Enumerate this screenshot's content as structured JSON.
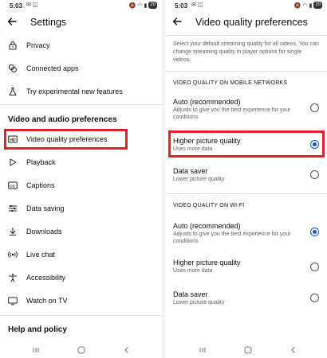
{
  "status_bar": {
    "time": "5:03",
    "battery": "20"
  },
  "settings": {
    "title": "Settings",
    "items_top": [
      {
        "label": "Privacy",
        "icon": "lock-icon"
      },
      {
        "label": "Connected apps",
        "icon": "link-icon"
      },
      {
        "label": "Try experimental new features",
        "icon": "flask-icon"
      }
    ],
    "section_video": "Video and audio preferences",
    "items_video": [
      {
        "label": "Video quality preferences",
        "icon": "hd-icon"
      },
      {
        "label": "Playback",
        "icon": "play-icon"
      },
      {
        "label": "Captions",
        "icon": "cc-icon"
      },
      {
        "label": "Data saving",
        "icon": "sliders-icon"
      },
      {
        "label": "Downloads",
        "icon": "download-icon"
      },
      {
        "label": "Live chat",
        "icon": "live-icon"
      },
      {
        "label": "Accessibility",
        "icon": "accessibility-icon"
      },
      {
        "label": "Watch on TV",
        "icon": "tv-icon"
      }
    ],
    "section_help": "Help and policy"
  },
  "video_quality": {
    "title": "Video quality preferences",
    "intro": "Select your default streaming quality for all videos. You can change streaming quality in player options for single videos.",
    "mobile_header": "VIDEO QUALITY ON MOBILE NETWORKS",
    "mobile_options": [
      {
        "title": "Auto (recommended)",
        "desc": "Adjusts to give you the best experience for your conditions",
        "selected": false
      },
      {
        "title": "Higher picture quality",
        "desc": "Uses more data",
        "selected": true
      },
      {
        "title": "Data saver",
        "desc": "Lower picture quality",
        "selected": false
      }
    ],
    "wifi_header": "VIDEO QUALITY ON WI-FI",
    "wifi_options": [
      {
        "title": "Auto (recommended)",
        "desc": "Adjusts to give you the best experience for your conditions",
        "selected": true
      },
      {
        "title": "Higher picture quality",
        "desc": "Uses more data",
        "selected": false
      },
      {
        "title": "Data saver",
        "desc": "Lower picture quality",
        "selected": false
      }
    ]
  },
  "colors": {
    "highlight": "#e0202a",
    "radio_selected": "#0b57d0",
    "secondary_text": "#606060"
  }
}
